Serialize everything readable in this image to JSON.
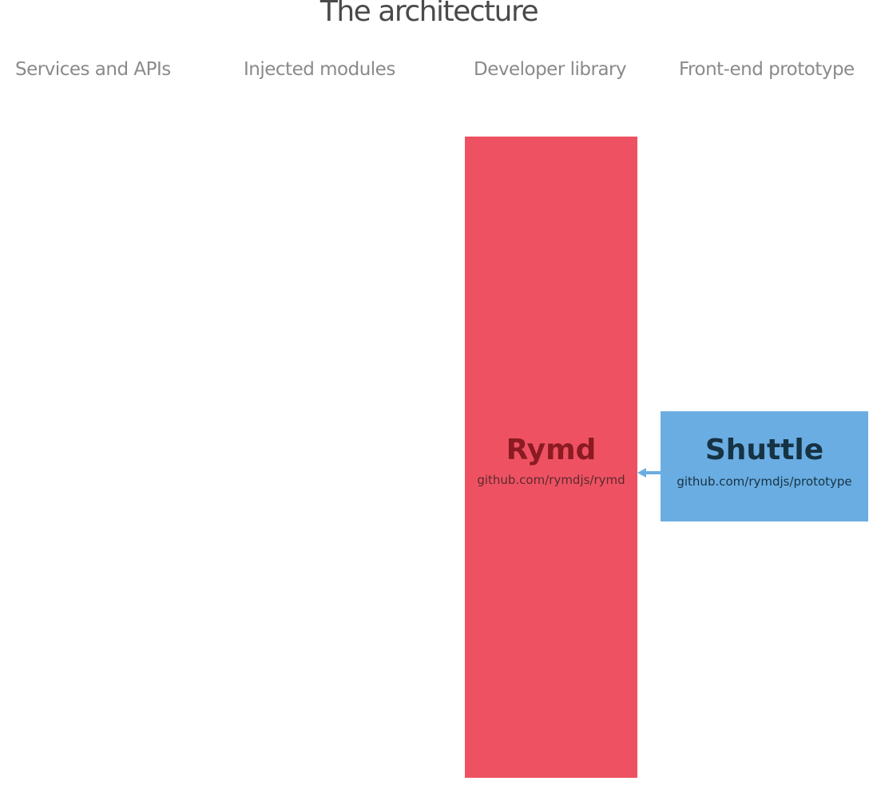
{
  "title": "The architecture",
  "columns": [
    "Services and APIs",
    "Injected modules",
    "Developer library",
    "Front-end prototype"
  ],
  "nodes": {
    "rymd": {
      "name": "Rymd",
      "url": "github.com/rymdjs/rymd",
      "color": "#ee5262"
    },
    "shuttle": {
      "name": "Shuttle",
      "url": "github.com/rymdjs/prototype",
      "color": "#6aade2"
    }
  },
  "edges": [
    {
      "from": "shuttle",
      "to": "rymd",
      "color": "#6aade2"
    }
  ]
}
